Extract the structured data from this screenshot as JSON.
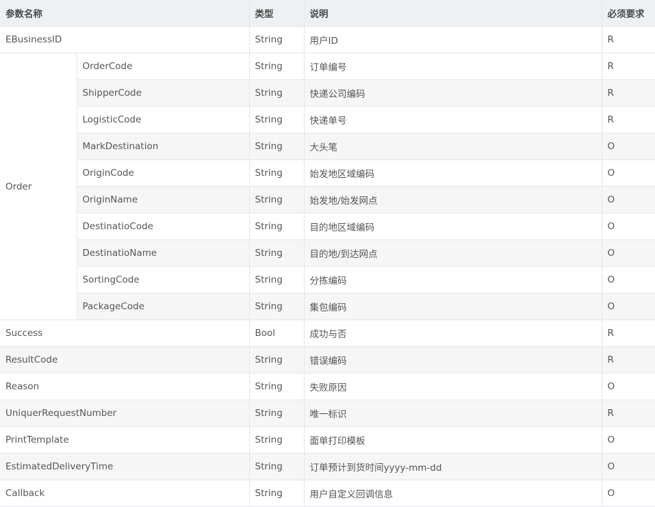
{
  "headers": [
    "参数名称",
    "类型",
    "说明",
    "必须要求"
  ],
  "rows": [
    {
      "name": "EBusinessID",
      "type": "String",
      "desc": "用户ID",
      "req": "R"
    },
    {
      "group": "Order",
      "name": "OrderCode",
      "type": "String",
      "desc": "订单编号",
      "req": "R"
    },
    {
      "name": "ShipperCode",
      "type": "String",
      "desc": "快递公司编码",
      "req": "R"
    },
    {
      "name": "LogisticCode",
      "type": "String",
      "desc": "快递单号",
      "req": "R"
    },
    {
      "name": "MarkDestination",
      "type": "String",
      "desc": "大头笔",
      "req": "O"
    },
    {
      "name": "OriginCode",
      "type": "String",
      "desc": "始发地区域编码",
      "req": "O"
    },
    {
      "name": "OriginName",
      "type": "String",
      "desc": "始发地/始发网点",
      "req": "O"
    },
    {
      "name": "DestinatioCode",
      "type": "String",
      "desc": "目的地区域编码",
      "req": "O"
    },
    {
      "name": "DestinatioName",
      "type": "String",
      "desc": "目的地/到达网点",
      "req": "O"
    },
    {
      "name": "SortingCode",
      "type": "String",
      "desc": "分拣编码",
      "req": "O"
    },
    {
      "name": "PackageCode",
      "type": "String",
      "desc": "集包编码",
      "req": "O"
    },
    {
      "name": "Success",
      "type": "Bool",
      "desc": "成功与否",
      "req": "R"
    },
    {
      "name": "ResultCode",
      "type": "String",
      "desc": "错误编码",
      "req": "R"
    },
    {
      "name": "Reason",
      "type": "String",
      "desc": "失败原因",
      "req": "O"
    },
    {
      "name": "UniquerRequestNumber",
      "type": "String",
      "desc": "唯一标识",
      "req": "R"
    },
    {
      "name": "PrintTemplate",
      "type": "String",
      "desc": "面单打印模板",
      "req": "O"
    },
    {
      "name": "EstimatedDeliveryTime",
      "type": "String",
      "desc": "订单预计到货时间yyyy-mm-dd",
      "req": "O"
    },
    {
      "name": "Callback",
      "type": "String",
      "desc": "用户自定义回调信息",
      "req": "O"
    }
  ]
}
